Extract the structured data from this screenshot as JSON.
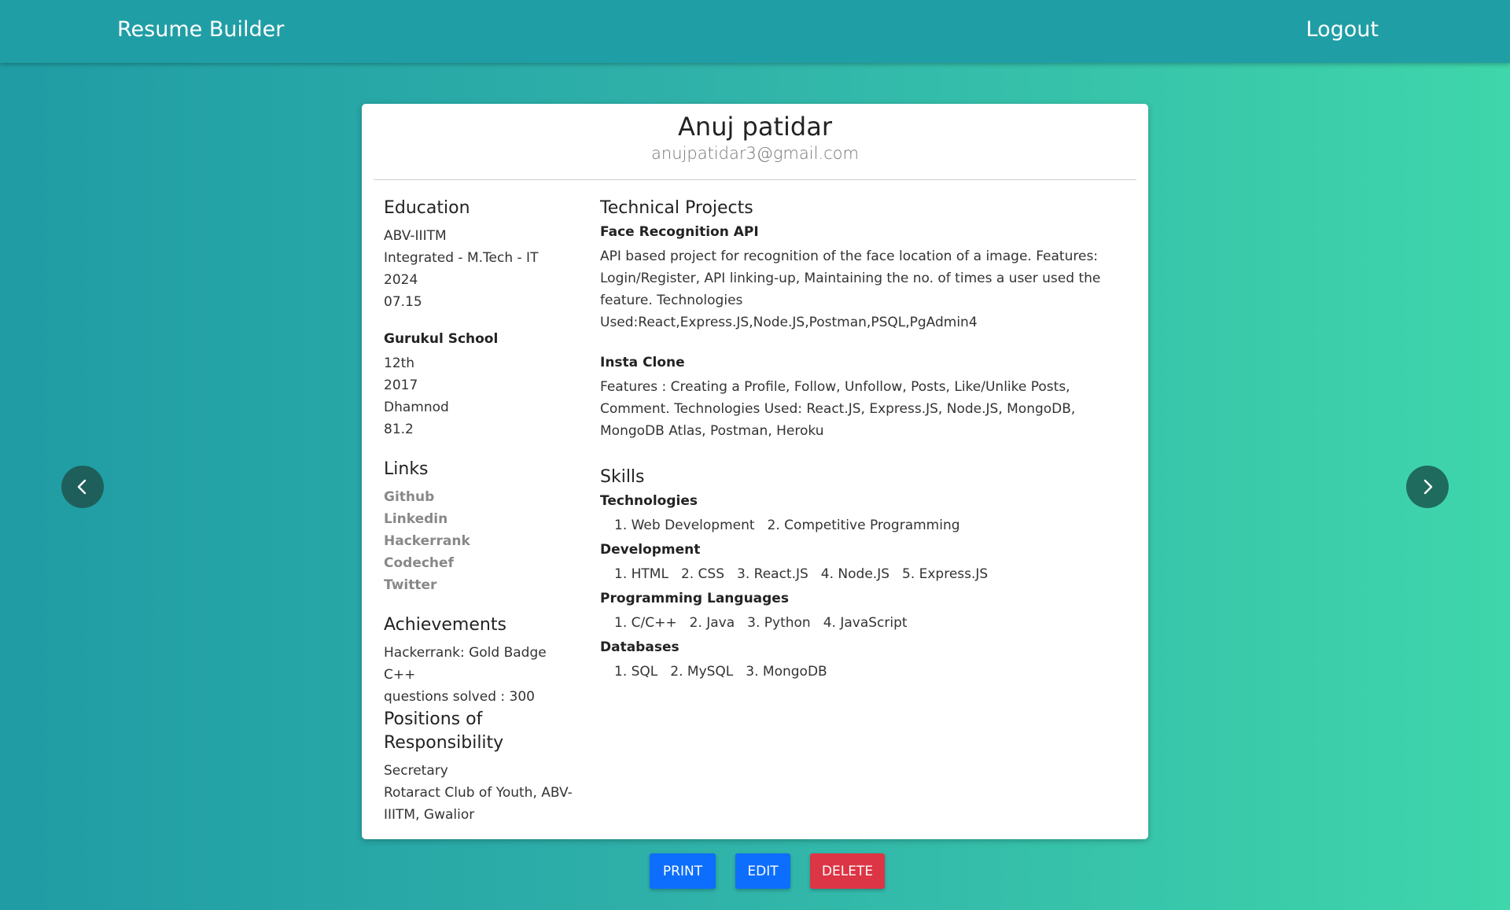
{
  "nav": {
    "brand": "Resume Builder",
    "logout": "Logout"
  },
  "resume": {
    "name": "Anuj patidar",
    "email": "anujpatidar3@gmail.com",
    "education": {
      "title": "Education",
      "entries": [
        {
          "institute": "ABV-IIITM",
          "lines": [
            "Integrated - M.Tech - IT",
            "2024",
            "07.15"
          ]
        },
        {
          "institute": "Gurukul School",
          "lines": [
            "12th",
            "2017",
            "Dhamnod",
            "81.2"
          ]
        }
      ]
    },
    "links": {
      "title": "Links",
      "items": [
        "Github",
        "Linkedin",
        "Hackerrank",
        "Codechef",
        "Twitter"
      ]
    },
    "achievements": {
      "title": "Achievements",
      "lines": [
        "Hackerrank: Gold Badge C++",
        "questions solved : 300"
      ]
    },
    "positions": {
      "title": "Positions of Responsibility",
      "role": "Secretary",
      "org": "Rotaract Club of Youth, ABV-IIITM, Gwalior"
    },
    "projects": {
      "title": "Technical Projects",
      "items": [
        {
          "name": "Face Recognition API",
          "desc": "API based project for recognition of the face location of a image. Features: Login/Register, API linking-up, Maintaining the no. of times a user used the feature. Technologies Used:React,Express.JS,Node.JS,Postman,PSQL,PgAdmin4"
        },
        {
          "name": "Insta Clone",
          "desc": "Features : Creating a Profile, Follow, Unfollow, Posts, Like/Unlike Posts, Comment. Technologies Used: React.JS, Express.JS, Node.JS, MongoDB, MongoDB Atlas, Postman, Heroku"
        }
      ]
    },
    "skills": {
      "title": "Skills",
      "groups": [
        {
          "name": "Technologies",
          "items": [
            "1. Web Development",
            "2. Competitive Programming"
          ]
        },
        {
          "name": "Development",
          "items": [
            "1. HTML",
            "2. CSS",
            "3. React.JS",
            "4. Node.JS",
            "5. Express.JS"
          ]
        },
        {
          "name": "Programming Languages",
          "items": [
            "1. C/C++",
            "2. Java",
            "3. Python",
            "4. JavaScript"
          ]
        },
        {
          "name": "Databases",
          "items": [
            "1. SQL",
            "2. MySQL",
            "3. MongoDB"
          ]
        }
      ]
    }
  },
  "buttons": {
    "print": "PRINT",
    "edit": "EDIT",
    "delete": "DELETE"
  },
  "icons": {
    "prev": "chevron-left-icon",
    "next": "chevron-right-icon"
  },
  "colors": {
    "primary": "#0d6efd",
    "danger": "#dc3545",
    "nav": "#209ea5"
  }
}
